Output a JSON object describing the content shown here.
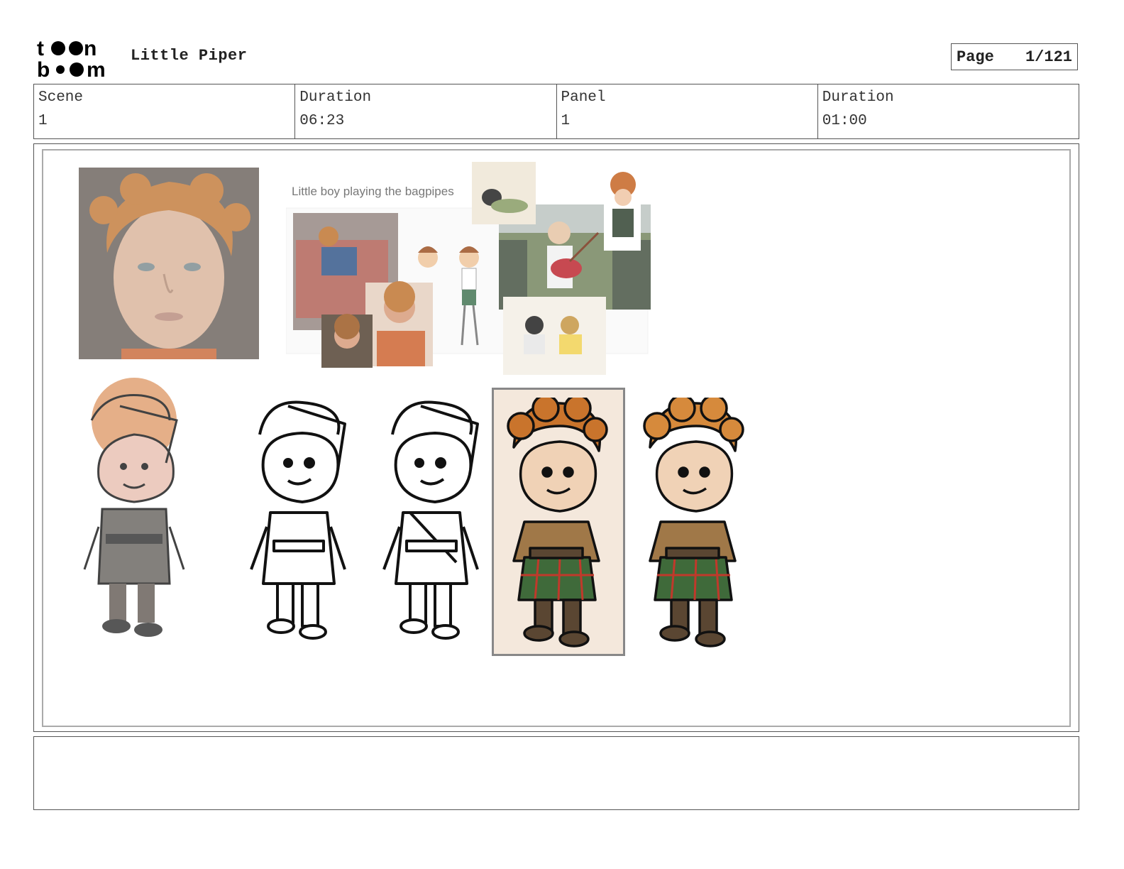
{
  "header": {
    "brand_name": "toon boom",
    "project_title": "Little Piper",
    "page_label": "Page",
    "page_value": "1/121"
  },
  "info": {
    "scene_label": "Scene",
    "scene_value": "1",
    "scene_duration_label": "Duration",
    "scene_duration_value": "06:23",
    "panel_label": "Panel",
    "panel_value": "1",
    "panel_duration_label": "Duration",
    "panel_duration_value": "01:00"
  },
  "panel": {
    "reference_caption": "Little boy playing the bagpipes"
  },
  "colors": {
    "frame": "#555555",
    "hair": "#c9742c",
    "tartan_green": "#3f6a3a",
    "tartan_red": "#c0392b",
    "jacket": "#a07848",
    "boots": "#5a4632",
    "highlight_bg": "#f4e8dc"
  },
  "notes": {
    "text": ""
  }
}
